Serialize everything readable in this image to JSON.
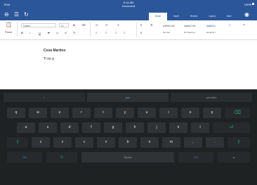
{
  "status": {
    "left": "iPad",
    "time": "9:14 AM",
    "title": "Document",
    "right": "100%"
  },
  "ribbon": {
    "tabs": [
      {
        "label": "Home",
        "active": true
      },
      {
        "label": "Insert",
        "active": false
      },
      {
        "label": "Review",
        "active": false
      },
      {
        "label": "Layout",
        "active": false
      },
      {
        "label": "View",
        "active": false
      }
    ],
    "icons": [
      "back-icon",
      "list-icon",
      "refresh-icon",
      "share-icon"
    ]
  },
  "tools": {
    "font_name": "Calibri",
    "font_size": "11",
    "bold": "B",
    "italic": "I",
    "underline": "U",
    "strike": "S",
    "sub": "x₂",
    "sup": "x²",
    "styles": [
      "AaBbCcDc",
      "AaBbCcDc",
      "AaBbCc"
    ],
    "style_names": [
      "Normal",
      "No Spacing",
      "Heading 1"
    ]
  },
  "document": {
    "lines": [
      "Cesa Martino",
      "Ti iro p"
    ]
  },
  "keyboard": {
    "predictions": [
      "i",
      "pro",
      "pensible"
    ],
    "row1": [
      "q",
      "w",
      "e",
      "r",
      "t",
      "y",
      "u",
      "i",
      "o",
      "p"
    ],
    "row2": [
      "a",
      "s",
      "d",
      "f",
      "g",
      "h",
      "j",
      "k",
      "l"
    ],
    "row3": [
      "z",
      "x",
      "c",
      "v",
      "b",
      "n",
      "m"
    ],
    "row4": {
      "left": "123",
      "space": "Space",
      "right": "123"
    },
    "accent": "#2e9e6b",
    "key_color": "#2f3336"
  }
}
